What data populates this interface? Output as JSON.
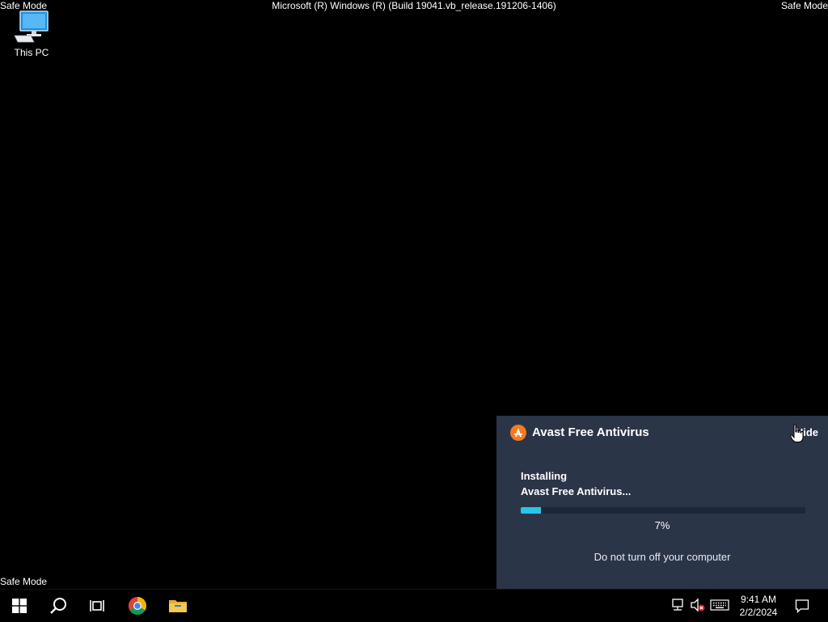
{
  "screen": {
    "safe_mode_label": "Safe Mode",
    "build_banner": "Microsoft (R) Windows (R) (Build 19041.vb_release.191206-1406)"
  },
  "desktop": {
    "icons": [
      {
        "label": "This PC",
        "icon": "computer-icon"
      }
    ]
  },
  "install_panel": {
    "app_name": "Avast Free Antivirus",
    "hide_label": "Hide",
    "status_line1": "Installing",
    "status_line2": "Avast Free Antivirus...",
    "progress_percent": 7,
    "progress_text": "7%",
    "warning": "Do not turn off your computer",
    "brand_color": "#f47b20",
    "accent_color": "#26c7e9"
  },
  "taskbar": {
    "buttons": [
      "windows-start-icon",
      "search-icon",
      "task-view-icon",
      "chrome-icon",
      "file-explorer-icon"
    ],
    "tray": [
      "network-icon",
      "volume-muted-icon",
      "keyboard-icon"
    ],
    "clock": {
      "time": "9:41 AM",
      "date": "2/2/2024"
    },
    "notifications_icon": "notification-icon"
  }
}
